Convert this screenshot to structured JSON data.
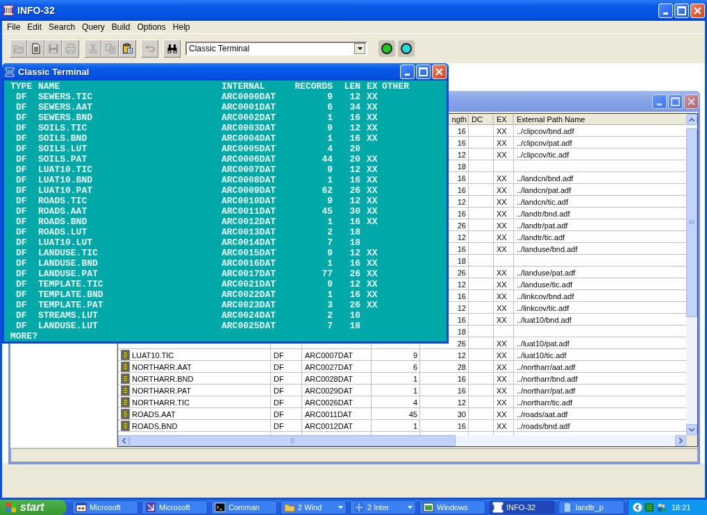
{
  "app": {
    "title": "INFO-32"
  },
  "menu": [
    "File",
    "Edit",
    "Search",
    "Query",
    "Build",
    "Options",
    "Help"
  ],
  "toolbar": {
    "button_groups": [
      [
        {
          "disabled": true
        },
        {
          "disabled": false
        },
        {
          "disabled": true
        },
        {
          "disabled": true
        }
      ],
      [
        {
          "disabled": true
        },
        {
          "disabled": true
        },
        {
          "disabled": false
        }
      ],
      [
        {
          "disabled": true
        }
      ],
      [
        {
          "disabled": false
        }
      ]
    ],
    "combo": {
      "value": "Classic Terminal"
    },
    "indicators": [
      {
        "color": "#1ec81e"
      },
      {
        "color": "#1edcdc"
      }
    ]
  },
  "table_window": {
    "columns": [
      "ngth",
      "DC",
      "EX",
      "External Path Name"
    ],
    "rows": [
      {
        "length": "16",
        "ex": "XX",
        "path": "../clipcov/bnd.adf"
      },
      {
        "length": "16",
        "ex": "XX",
        "path": "../clipcov/pat.adf"
      },
      {
        "length": "12",
        "ex": "XX",
        "path": "../clipcov/tic.adf"
      },
      {
        "length": "18"
      },
      {
        "length": "16",
        "ex": "XX",
        "path": "../landcn/bnd.adf"
      },
      {
        "length": "16",
        "ex": "XX",
        "path": "../landcn/pat.adf"
      },
      {
        "length": "12",
        "ex": "XX",
        "path": "../landcn/tic.adf"
      },
      {
        "length": "16",
        "ex": "XX",
        "path": "../landtr/bnd.adf"
      },
      {
        "length": "26",
        "ex": "XX",
        "path": "../landtr/pat.adf"
      },
      {
        "length": "12",
        "ex": "XX",
        "path": "../landtr/tic.adf"
      },
      {
        "length": "16",
        "ex": "XX",
        "path": "../landuse/bnd.adf"
      },
      {
        "length": "18"
      },
      {
        "length": "26",
        "ex": "XX",
        "path": "../landuse/pat.adf"
      },
      {
        "length": "12",
        "ex": "XX",
        "path": "../landuse/tic.adf"
      },
      {
        "length": "16",
        "ex": "XX",
        "path": "../linkcov/bnd.adf"
      },
      {
        "length": "12",
        "ex": "XX",
        "path": "../linkcov/tic.adf"
      },
      {
        "length": "16",
        "ex": "XX",
        "path": "../luat10/bnd.adf"
      },
      {
        "length": "18"
      },
      {
        "length": "26",
        "ex": "XX",
        "path": "../luat10/pat.adf"
      },
      {
        "name": "LUAT10.TIC",
        "type": "DF",
        "internal": "ARC0007DAT",
        "records": "9",
        "length": "12",
        "ex": "XX",
        "path": "../luat10/tic.adf"
      },
      {
        "name": "NORTHARR.AAT",
        "type": "DF",
        "internal": "ARC0027DAT",
        "records": "6",
        "length": "28",
        "ex": "XX",
        "path": "../northarr/aat.adf"
      },
      {
        "name": "NORTHARR.BND",
        "type": "DF",
        "internal": "ARC0028DAT",
        "records": "1",
        "length": "16",
        "ex": "XX",
        "path": "../northarr/bnd.adf"
      },
      {
        "name": "NORTHARR.PAT",
        "type": "DF",
        "internal": "ARC0029DAT",
        "records": "1",
        "length": "16",
        "ex": "XX",
        "path": "../northarr/pat.adf"
      },
      {
        "name": "NORTHARR.TIC",
        "type": "DF",
        "internal": "ARC0026DAT",
        "records": "4",
        "length": "12",
        "ex": "XX",
        "path": "../northarr/tic.adf"
      },
      {
        "name": "ROADS.AAT",
        "type": "DF",
        "internal": "ARC0011DAT",
        "records": "45",
        "length": "30",
        "ex": "XX",
        "path": "../roads/aat.adf"
      },
      {
        "name": "ROADS.BND",
        "type": "DF",
        "internal": "ARC0012DAT",
        "records": "1",
        "length": "16",
        "ex": "XX",
        "path": "../roads/bnd.adf"
      }
    ]
  },
  "terminal": {
    "title": "Classic Terminal",
    "header": {
      "type": "TYPE",
      "name": "NAME",
      "internal": "INTERNAL",
      "records": "RECORDS",
      "len": "LEN",
      "ex": "EX",
      "other": "OTHER"
    },
    "rows": [
      {
        "type": "DF",
        "name": "SEWERS.TIC",
        "internal": "ARC0000DAT",
        "records": "9",
        "len": "12",
        "ex": "XX"
      },
      {
        "type": "DF",
        "name": "SEWERS.AAT",
        "internal": "ARC0001DAT",
        "records": "6",
        "len": "34",
        "ex": "XX"
      },
      {
        "type": "DF",
        "name": "SEWERS.BND",
        "internal": "ARC0002DAT",
        "records": "1",
        "len": "16",
        "ex": "XX"
      },
      {
        "type": "DF",
        "name": "SOILS.TIC",
        "internal": "ARC0003DAT",
        "records": "9",
        "len": "12",
        "ex": "XX"
      },
      {
        "type": "DF",
        "name": "SOILS.BND",
        "internal": "ARC0004DAT",
        "records": "1",
        "len": "16",
        "ex": "XX"
      },
      {
        "type": "DF",
        "name": "SOILS.LUT",
        "internal": "ARC0005DAT",
        "records": "4",
        "len": "20"
      },
      {
        "type": "DF",
        "name": "SOILS.PAT",
        "internal": "ARC0006DAT",
        "records": "44",
        "len": "20",
        "ex": "XX"
      },
      {
        "type": "DF",
        "name": "LUAT10.TIC",
        "internal": "ARC0007DAT",
        "records": "9",
        "len": "12",
        "ex": "XX"
      },
      {
        "type": "DF",
        "name": "LUAT10.BND",
        "internal": "ARC0008DAT",
        "records": "1",
        "len": "16",
        "ex": "XX"
      },
      {
        "type": "DF",
        "name": "LUAT10.PAT",
        "internal": "ARC0009DAT",
        "records": "62",
        "len": "26",
        "ex": "XX"
      },
      {
        "type": "DF",
        "name": "ROADS.TIC",
        "internal": "ARC0010DAT",
        "records": "9",
        "len": "12",
        "ex": "XX"
      },
      {
        "type": "DF",
        "name": "ROADS.AAT",
        "internal": "ARC0011DAT",
        "records": "45",
        "len": "30",
        "ex": "XX"
      },
      {
        "type": "DF",
        "name": "ROADS.BND",
        "internal": "ARC0012DAT",
        "records": "1",
        "len": "16",
        "ex": "XX"
      },
      {
        "type": "DF",
        "name": "ROADS.LUT",
        "internal": "ARC0013DAT",
        "records": "2",
        "len": "18"
      },
      {
        "type": "DF",
        "name": "LUAT10.LUT",
        "internal": "ARC0014DAT",
        "records": "7",
        "len": "18"
      },
      {
        "type": "DF",
        "name": "LANDUSE.TIC",
        "internal": "ARC0015DAT",
        "records": "9",
        "len": "12",
        "ex": "XX"
      },
      {
        "type": "DF",
        "name": "LANDUSE.BND",
        "internal": "ARC0016DAT",
        "records": "1",
        "len": "16",
        "ex": "XX"
      },
      {
        "type": "DF",
        "name": "LANDUSE.PAT",
        "internal": "ARC0017DAT",
        "records": "77",
        "len": "26",
        "ex": "XX"
      },
      {
        "type": "DF",
        "name": "TEMPLATE.TIC",
        "internal": "ARC0021DAT",
        "records": "9",
        "len": "12",
        "ex": "XX"
      },
      {
        "type": "DF",
        "name": "TEMPLATE.BND",
        "internal": "ARC0022DAT",
        "records": "1",
        "len": "16",
        "ex": "XX"
      },
      {
        "type": "DF",
        "name": "TEMPLATE.PAT",
        "internal": "ARC0023DAT",
        "records": "3",
        "len": "26",
        "ex": "XX"
      },
      {
        "type": "DF",
        "name": "STREAMS.LUT",
        "internal": "ARC0024DAT",
        "records": "2",
        "len": "10"
      },
      {
        "type": "DF",
        "name": "LANDUSE.LUT",
        "internal": "ARC0025DAT",
        "records": "7",
        "len": "18"
      }
    ],
    "prompt": "MORE?"
  },
  "taskbar": {
    "start": "start",
    "items": [
      {
        "label": "Microsoft",
        "grouped": false,
        "selected": false
      },
      {
        "label": "Microsoft",
        "grouped": false,
        "selected": false
      },
      {
        "label": "Comman",
        "grouped": false,
        "selected": false
      },
      {
        "label": "2 Wind",
        "grouped": true,
        "selected": false
      },
      {
        "label": "2 Inter",
        "grouped": true,
        "selected": false
      },
      {
        "label": "Windows",
        "grouped": false,
        "selected": false
      },
      {
        "label": "INFO-32",
        "grouped": false,
        "selected": true
      },
      {
        "label": "landtr_p",
        "grouped": false,
        "selected": false
      }
    ],
    "clock": "18:21"
  }
}
